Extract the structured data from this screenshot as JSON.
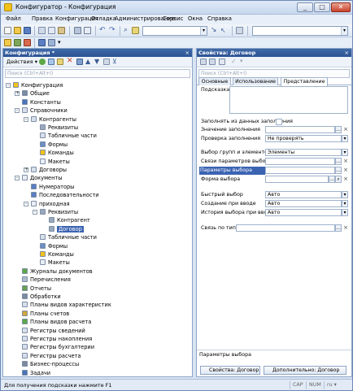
{
  "window": {
    "title": "Конфигуратор - Конфигурация",
    "min": "_",
    "max": "□",
    "close": "✕"
  },
  "menu": [
    "Файл",
    "Правка",
    "Конфигурация",
    "Отладка",
    "Администрирование",
    "Сервис",
    "Окна",
    "Справка"
  ],
  "left_panel": {
    "title": "Конфигурация *",
    "close": "×",
    "actions_label": "Действия ▾",
    "search_placeholder": "Поиск (Ctrl+Alt+I)",
    "tree": [
      {
        "label": "Конфигурация",
        "depth": 0,
        "icon": "yellow",
        "exp": "-"
      },
      {
        "label": "Общие",
        "depth": 1,
        "icon": "gear",
        "exp": "+"
      },
      {
        "label": "Константы",
        "depth": 1,
        "icon": "blue",
        "exp": ""
      },
      {
        "label": "Справочники",
        "depth": 1,
        "icon": "table",
        "exp": "-"
      },
      {
        "label": "Контрагенты",
        "depth": 2,
        "icon": "table",
        "exp": "-"
      },
      {
        "label": "Реквизиты",
        "depth": 3,
        "icon": "dash",
        "exp": ""
      },
      {
        "label": "Табличные части",
        "depth": 3,
        "icon": "table",
        "exp": ""
      },
      {
        "label": "Формы",
        "depth": 3,
        "icon": "form",
        "exp": ""
      },
      {
        "label": "Команды",
        "depth": 3,
        "icon": "yellow",
        "exp": ""
      },
      {
        "label": "Макеты",
        "depth": 3,
        "icon": "doc",
        "exp": ""
      },
      {
        "label": "Договоры",
        "depth": 2,
        "icon": "table",
        "exp": "+"
      },
      {
        "label": "Документы",
        "depth": 1,
        "icon": "doc",
        "exp": "-"
      },
      {
        "label": "Нумераторы",
        "depth": 2,
        "icon": "num",
        "exp": ""
      },
      {
        "label": "Последовательности",
        "depth": 2,
        "icon": "seq",
        "exp": ""
      },
      {
        "label": "приходная",
        "depth": 2,
        "icon": "doc",
        "exp": "-"
      },
      {
        "label": "Реквизиты",
        "depth": 3,
        "icon": "dash",
        "exp": "-"
      },
      {
        "label": "Контрагент",
        "depth": 4,
        "icon": "dash",
        "exp": ""
      },
      {
        "label": "Договор",
        "depth": 4,
        "icon": "dash",
        "exp": "",
        "selected": true
      },
      {
        "label": "Табличные части",
        "depth": 3,
        "icon": "table",
        "exp": ""
      },
      {
        "label": "Формы",
        "depth": 3,
        "icon": "form",
        "exp": ""
      },
      {
        "label": "Команды",
        "depth": 3,
        "icon": "yellow",
        "exp": ""
      },
      {
        "label": "Макеты",
        "depth": 3,
        "icon": "doc",
        "exp": ""
      },
      {
        "label": "Журналы документов",
        "depth": 1,
        "icon": "green",
        "exp": ""
      },
      {
        "label": "Перечисления",
        "depth": 1,
        "icon": "list",
        "exp": ""
      },
      {
        "label": "Отчеты",
        "depth": 1,
        "icon": "report",
        "exp": ""
      },
      {
        "label": "Обработки",
        "depth": 1,
        "icon": "gear",
        "exp": ""
      },
      {
        "label": "Планы видов характеристик",
        "depth": 1,
        "icon": "table",
        "exp": ""
      },
      {
        "label": "Планы счетов",
        "depth": 1,
        "icon": "acc",
        "exp": ""
      },
      {
        "label": "Планы видов расчета",
        "depth": 1,
        "icon": "green",
        "exp": ""
      },
      {
        "label": "Регистры сведений",
        "depth": 1,
        "icon": "table",
        "exp": ""
      },
      {
        "label": "Регистры накопления",
        "depth": 1,
        "icon": "table",
        "exp": ""
      },
      {
        "label": "Регистры бухгалтерии",
        "depth": 1,
        "icon": "table",
        "exp": ""
      },
      {
        "label": "Регистры расчета",
        "depth": 1,
        "icon": "table",
        "exp": ""
      },
      {
        "label": "Бизнес-процессы",
        "depth": 1,
        "icon": "gear",
        "exp": ""
      },
      {
        "label": "Задачи",
        "depth": 1,
        "icon": "blue",
        "exp": ""
      }
    ]
  },
  "right_panel": {
    "title": "Свойства: Договор",
    "close": "×",
    "search_placeholder": "Поиск (Ctrl+Alt+I)",
    "tabs": [
      "Основные",
      "Использование",
      "Представление"
    ],
    "fields": {
      "podskazka": "Подсказка",
      "fill_from": "Заполнять из данных заполнения",
      "fill_value": "Значение заполнения",
      "fill_check": "Проверка заполнения",
      "fill_check_val": "Не проверять",
      "select_mode": "Выбор групп и элементов",
      "select_mode_val": "Элементы",
      "links": "Связи параметров выбора",
      "params": "Параметры выбора",
      "form": "Форма выбора",
      "quick": "Быстрый выбор",
      "quick_val": "Авто",
      "create": "Создание при вводе",
      "create_val": "Авто",
      "history": "История выбора при вводе",
      "history_val": "Авто",
      "type_link": "Связь по типу"
    },
    "hint": "Параметры выбора",
    "btn_props": "Свойства: Договор",
    "btn_extra": "Дополнительно: Договор"
  },
  "status": {
    "text": "Для получения подсказки нажмите F1",
    "cap": "CAP",
    "num": "NUM",
    "lang": "ru ▾"
  }
}
